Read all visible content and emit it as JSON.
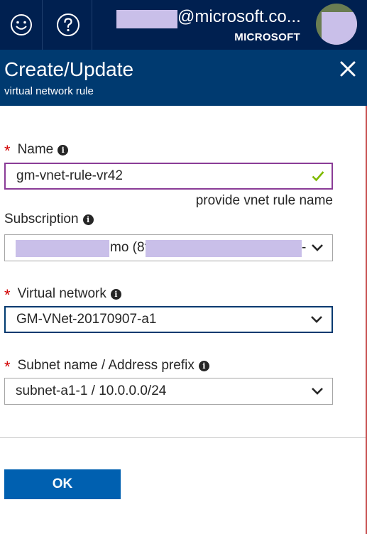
{
  "topbar": {
    "feedback_icon": "smiley-icon",
    "help_icon": "question-circle-icon",
    "email_visible_suffix": "@microsoft.co...",
    "tenant": "MICROSOFT"
  },
  "blade": {
    "title": "Create/Update",
    "subtitle": "virtual network rule",
    "close_icon": "close-icon"
  },
  "form": {
    "name": {
      "label": "Name",
      "required": "*",
      "value": "gm-vnet-rule-vr42",
      "hint": "provide vnet rule name",
      "valid": true
    },
    "subscription": {
      "label": "Subscription",
      "visible_fragment_1": "mo (8f",
      "visible_fragment_2": "-"
    },
    "virtual_network": {
      "label": "Virtual network",
      "required": "*",
      "value": "GM-VNet-20170907-a1"
    },
    "subnet": {
      "label": "Subnet name / Address prefix",
      "required": "*",
      "value": "subnet-a1-1 / 10.0.0.0/24"
    },
    "ok_label": "OK"
  },
  "colors": {
    "topbar_bg": "#002050",
    "header_bg": "#003a70",
    "primary_button": "#0060b0",
    "required_star": "#d10000",
    "valid_check": "#7fba00",
    "name_focus_border": "#8a3c97",
    "redaction": "#c9bfe9"
  }
}
